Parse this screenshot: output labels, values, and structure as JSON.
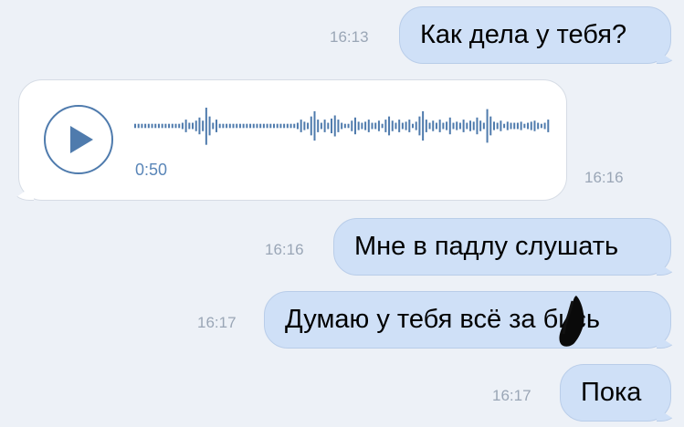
{
  "messages": [
    {
      "type": "outgoing",
      "text": "Как дела у тебя?",
      "time": "16:13"
    },
    {
      "type": "incoming-voice",
      "duration": "0:50",
      "time": "16:16"
    },
    {
      "type": "outgoing",
      "text": "Мне в падлу слушать",
      "time": "16:16"
    },
    {
      "type": "outgoing",
      "text": "Думаю у тебя всё за бись",
      "time": "16:17"
    },
    {
      "type": "outgoing",
      "text": "Пока",
      "time": "16:17"
    }
  ],
  "voice_message": {
    "duration": "0:50",
    "waveform_levels": [
      2,
      2,
      2,
      2,
      2,
      2,
      2,
      2,
      2,
      2,
      2,
      2,
      2,
      2,
      3,
      6,
      3,
      3,
      5,
      8,
      5,
      18,
      9,
      3,
      6,
      2,
      2,
      2,
      2,
      2,
      2,
      2,
      2,
      2,
      2,
      2,
      2,
      2,
      2,
      2,
      2,
      2,
      2,
      2,
      2,
      2,
      2,
      2,
      3,
      6,
      4,
      3,
      9,
      14,
      6,
      3,
      6,
      3,
      7,
      10,
      6,
      3,
      2,
      2,
      5,
      8,
      4,
      3,
      4,
      6,
      3,
      3,
      5,
      2,
      6,
      9,
      5,
      3,
      6,
      3,
      4,
      6,
      2,
      4,
      9,
      14,
      6,
      3,
      5,
      3,
      6,
      3,
      4,
      8,
      3,
      4,
      3,
      6,
      3,
      5,
      4,
      8,
      5,
      3,
      16,
      9,
      4,
      3,
      5,
      2,
      4,
      3,
      3,
      3,
      4,
      2,
      3,
      4,
      5,
      3,
      2,
      3,
      6
    ]
  },
  "colors": {
    "background": "#edf1f7",
    "outgoing_bubble": "#cfe0f7",
    "incoming_bubble": "#ffffff",
    "accent": "#4f7bad",
    "time_text": "#9aa6b6"
  }
}
